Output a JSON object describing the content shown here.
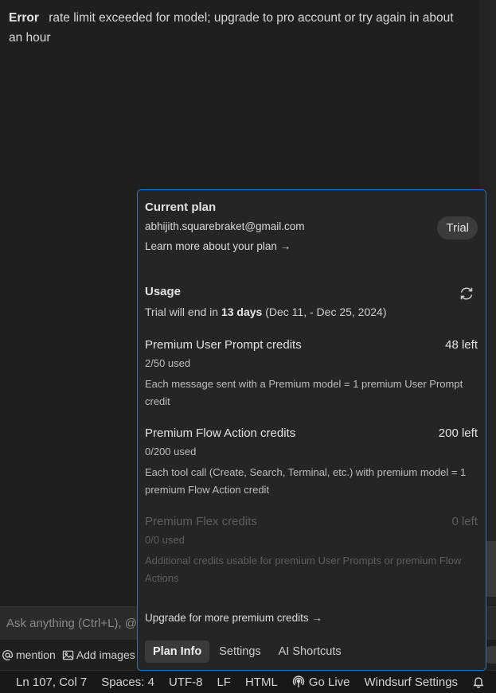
{
  "error": {
    "label": "Error",
    "message": "rate limit exceeded for model; upgrade to pro account or try again in about an hour"
  },
  "chat": {
    "placeholder": "Ask anything (Ctrl+L), @",
    "mention_label": "mention",
    "add_images_label": "Add images"
  },
  "status_bar": {
    "position": "Ln 107, Col 7",
    "spaces": "Spaces: 4",
    "encoding": "UTF-8",
    "eol": "LF",
    "language": "HTML",
    "go_live": "Go Live",
    "settings": "Windsurf Settings"
  },
  "popup": {
    "plan": {
      "title": "Current plan",
      "email": "abhijith.squarebraket@gmail.com",
      "learn_more": "Learn more about your plan →",
      "badge": "Trial"
    },
    "usage": {
      "title": "Usage",
      "trial_prefix": "Trial will end in",
      "trial_days": "13 days",
      "trial_range": "(Dec 11, - Dec 25, 2024)"
    },
    "credits": [
      {
        "title": "Premium User Prompt credits",
        "left": "48 left",
        "used": "2/50 used",
        "desc": "Each message sent with a Premium model = 1 premium User Prompt credit"
      },
      {
        "title": "Premium Flow Action credits",
        "left": "200 left",
        "used": "0/200 used",
        "desc": "Each tool call (Create, Search, Terminal, etc.) with premium model = 1 premium Flow Action credit"
      },
      {
        "title": "Premium Flex credits",
        "left": "0 left",
        "used": "0/0 used",
        "desc": "Additional credits usable for premium User Prompts or premium Flow Actions"
      }
    ],
    "upgrade": "Upgrade for more premium credits →",
    "tabs": [
      "Plan Info",
      "Settings",
      "AI Shortcuts"
    ]
  },
  "colors": {
    "background": "#1f1f1f",
    "popup_bg": "#252526",
    "popup_border": "#2f73b5",
    "status_bar": "#181818"
  }
}
